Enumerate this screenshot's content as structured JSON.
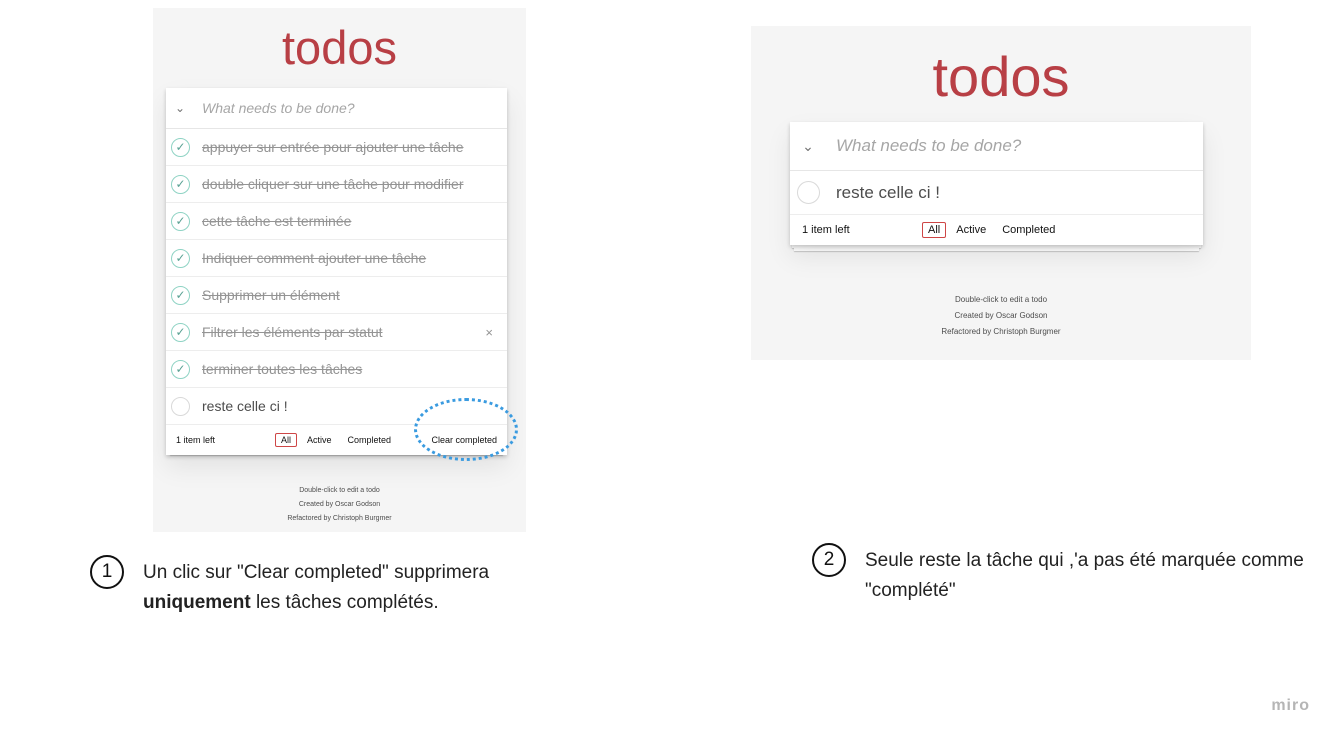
{
  "panel1": {
    "title": "todos",
    "toggle_icon": "⌄",
    "placeholder": "What needs to be done?",
    "todos": [
      {
        "label": "appuyer sur entrée pour ajouter une tâche",
        "completed": true
      },
      {
        "label": "double cliquer sur une tâche pour modifier",
        "completed": true
      },
      {
        "label": "cette tâche est terminée",
        "completed": true
      },
      {
        "label": "Indiquer comment ajouter une tâche",
        "completed": true
      },
      {
        "label": "Supprimer un élément",
        "completed": true
      },
      {
        "label": "Filtrer les éléments par statut",
        "completed": true
      },
      {
        "label": "terminer toutes les tâches",
        "completed": true
      },
      {
        "label": "reste celle ci !",
        "completed": false
      }
    ],
    "destroy_icon": "×",
    "footer": {
      "count": "1 item left",
      "filters": [
        "All",
        "Active",
        "Completed"
      ],
      "clear": "Clear completed"
    },
    "info": [
      "Double-click to edit a todo",
      "Created by Oscar Godson",
      "Refactored by Christoph Burgmer"
    ]
  },
  "panel2": {
    "title": "todos",
    "toggle_icon": "⌄",
    "placeholder": "What needs to be done?",
    "todos": [
      {
        "label": "reste celle ci !",
        "completed": false
      }
    ],
    "footer": {
      "count": "1 item left",
      "filters": [
        "All",
        "Active",
        "Completed"
      ]
    },
    "info": [
      "Double-click to edit a todo",
      "Created by Oscar Godson",
      "Refactored by Christoph Burgmer"
    ]
  },
  "captions": {
    "step1": {
      "number": "1",
      "text_before": "Un clic sur \"Clear completed\"  supprimera ",
      "text_bold": "uniquement",
      "text_after": " les tâches complétés."
    },
    "step2": {
      "number": "2",
      "text": "Seule reste la tâche qui ,'a pas été marquée comme  \"complété\""
    }
  },
  "brand": "miro",
  "colors": {
    "title_red": "#b83f45",
    "check_green": "#59a193",
    "highlight_blue": "#3a9be0",
    "selected_filter_border": "#ce4646"
  }
}
